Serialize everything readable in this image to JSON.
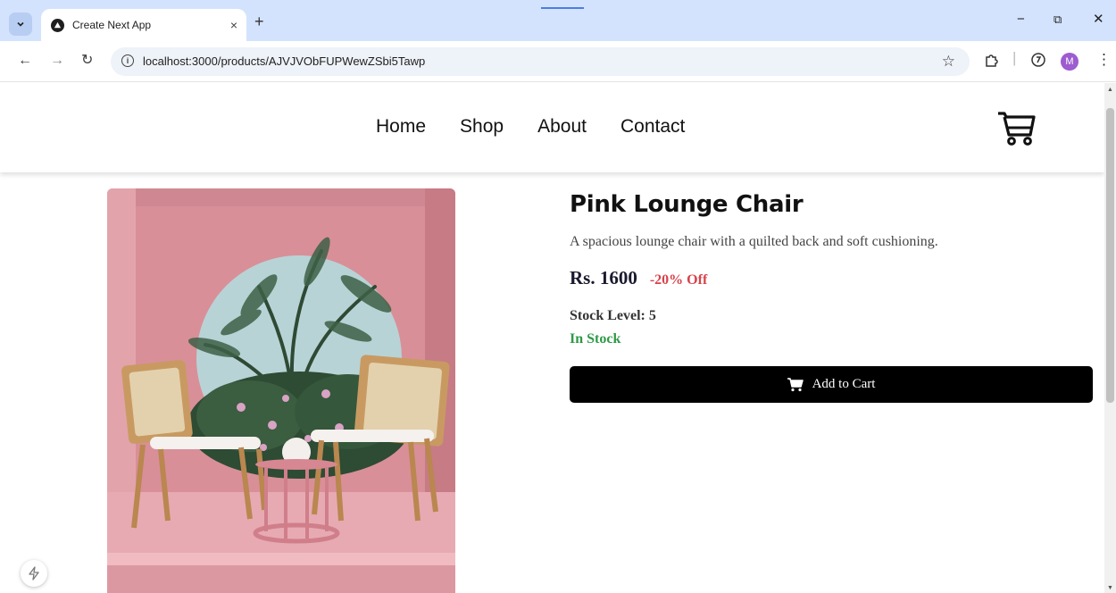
{
  "browser": {
    "tab_title": "Create Next App",
    "tab_close": "×",
    "new_tab": "+",
    "url": "localhost:3000/products/AJVJVObFUPWewZSbi5Tawp",
    "avatar_letter": "M",
    "window_controls": {
      "minimize": "−",
      "restore": "⧉",
      "close": "✕"
    },
    "icons": [
      "tab-list-icon",
      "back-icon",
      "forward-icon",
      "reload-icon",
      "site-info-icon",
      "bookmark-star-icon",
      "extensions-icon",
      "media-icon"
    ]
  },
  "header": {
    "nav": [
      {
        "label": "Home"
      },
      {
        "label": "Shop"
      },
      {
        "label": "About"
      },
      {
        "label": "Contact"
      }
    ],
    "cart_icon": "shopping-cart-icon"
  },
  "product": {
    "title": "Pink Lounge Chair",
    "description": "A spacious lounge chair with a quilted back and soft cushioning.",
    "price": "Rs. 1600",
    "discount": "-20% Off",
    "stock_level": "Stock Level: 5",
    "stock_status": "In Stock",
    "add_to_cart": "Add to Cart",
    "colors": {
      "discount": "#d9414a",
      "in_stock": "#2d9a46",
      "button": "#000000"
    }
  }
}
